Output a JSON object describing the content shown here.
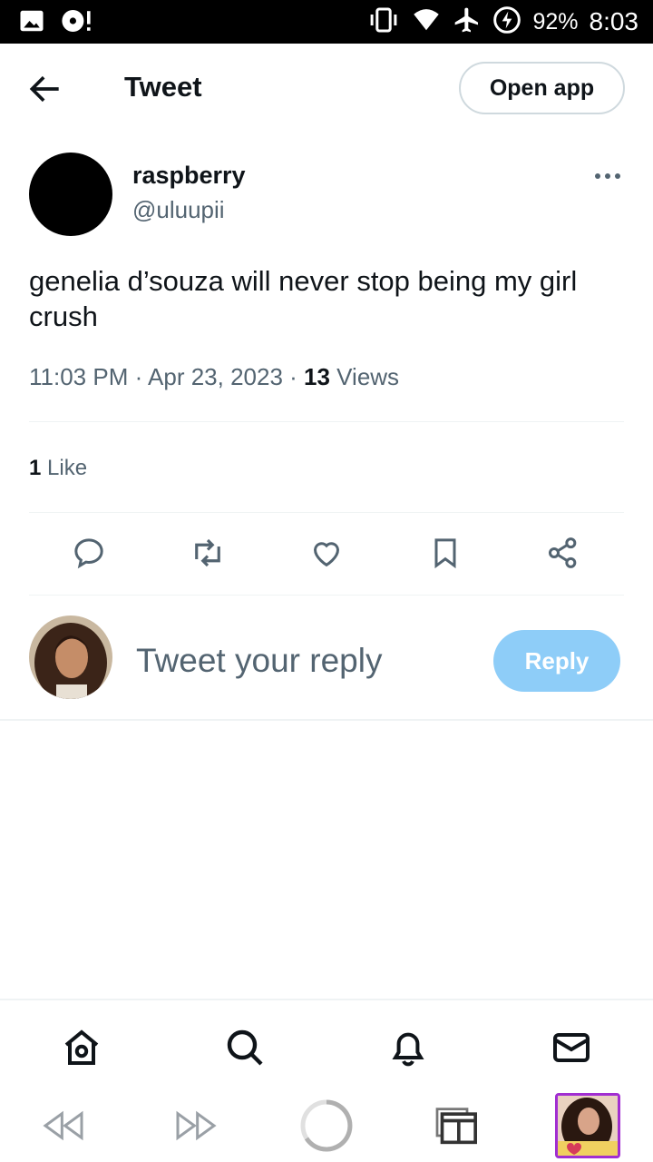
{
  "status_bar": {
    "battery": "92%",
    "time": "8:03"
  },
  "header": {
    "title": "Tweet",
    "open_app_label": "Open app"
  },
  "tweet": {
    "display_name": "raspberry",
    "handle": "@uluupii",
    "text": "genelia d’souza will never stop being my girl crush",
    "time": "11:03 PM",
    "separator": " · ",
    "date": "Apr 23, 2023",
    "views_count": "13",
    "views_label": " Views",
    "likes_count": "1",
    "likes_label": " Like"
  },
  "reply": {
    "placeholder": "Tweet your reply",
    "button_label": "Reply"
  },
  "colors": {
    "text_primary": "#0f1419",
    "text_secondary": "#536471",
    "reply_button": "#8ecdf8",
    "divider": "#eff3f4"
  },
  "icons": {
    "actions": [
      "comment-icon",
      "retweet-icon",
      "like-icon",
      "bookmark-icon",
      "share-icon"
    ],
    "bottom_nav": [
      "home-icon",
      "search-icon",
      "notifications-icon",
      "messages-icon"
    ],
    "browser": [
      "rewind-icon",
      "fast-forward-icon",
      "loading-icon",
      "tabs-icon"
    ]
  }
}
